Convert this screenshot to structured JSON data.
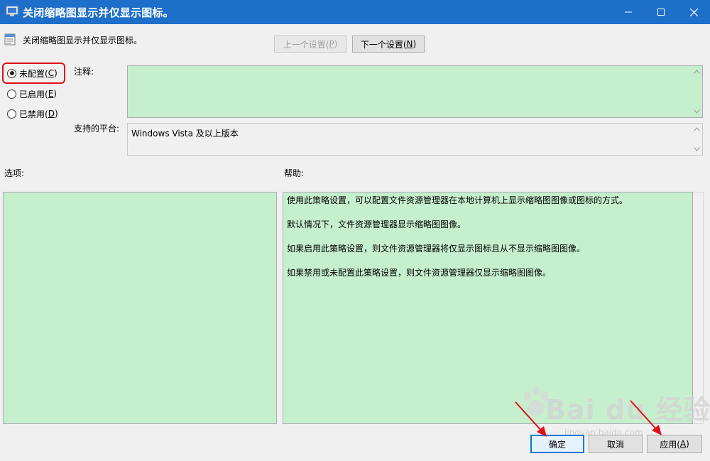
{
  "window": {
    "title": "关闭缩略图显示并仅显示图标。",
    "title_bar_color": "#1e6fc9"
  },
  "policy": {
    "name": "关闭缩略图显示并仅显示图标。"
  },
  "nav": {
    "prev_label": "上一个设置(",
    "prev_key": "P",
    "next_label": "下一个设置(",
    "next_key": "N",
    "close_paren": ")"
  },
  "radios": [
    {
      "label": "未配置(",
      "key": "C",
      "checked": true
    },
    {
      "label": "已启用(",
      "key": "E",
      "checked": false
    },
    {
      "label": "已禁用(",
      "key": "D",
      "checked": false
    }
  ],
  "labels": {
    "comment": "注释:",
    "platform": "支持的平台:",
    "options": "选项:",
    "help": "帮助:"
  },
  "platform_value": "Windows Vista 及以上版本",
  "help_paragraphs": [
    "使用此策略设置，可以配置文件资源管理器在本地计算机上显示缩略图图像或图标的方式。",
    "默认情况下，文件资源管理器显示缩略图图像。",
    "如果启用此策略设置，则文件资源管理器将仅显示图标且从不显示缩略图图像。",
    "如果禁用或未配置此策略设置，则文件资源管理器仅显示缩略图图像。"
  ],
  "buttons": {
    "ok": "确定",
    "cancel": "取消",
    "apply_label": "应用(",
    "apply_key": "A",
    "close_paren": ")"
  },
  "watermark": {
    "logo_text": "Bai du 经验",
    "url": "jingyan.baidu.com"
  },
  "colors": {
    "field_fill": "#c6efce",
    "highlight": "#e0101a",
    "annotation_arrow": "#e0101a",
    "focus_border": "#0078d7"
  },
  "icons": {
    "title": "policy-window-icon",
    "policy": "policy-setting-icon",
    "minimize": "minimize-icon",
    "maximize": "maximize-icon",
    "close": "close-icon"
  }
}
